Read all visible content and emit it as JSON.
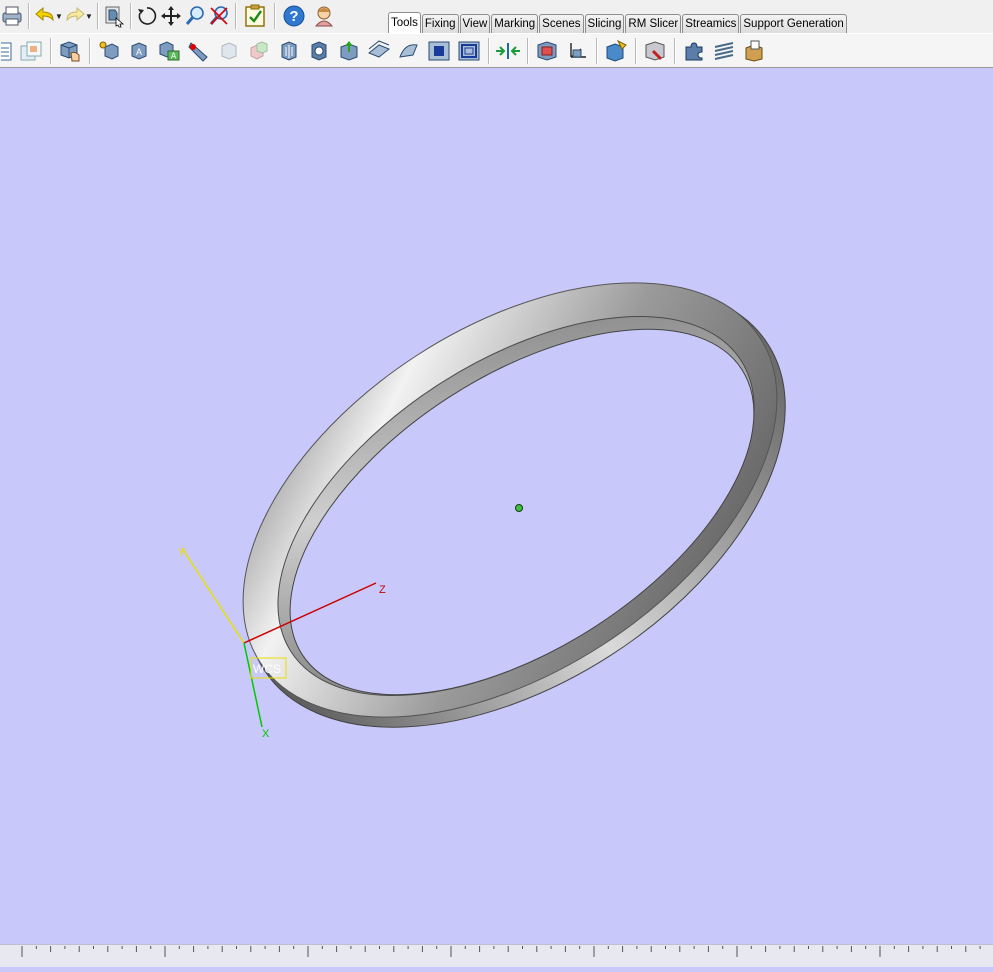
{
  "toolbar": {
    "top_icons": [
      "print-icon",
      "undo-icon",
      "redo-icon",
      "select-part-icon",
      "rotate-icon",
      "pan-icon",
      "zoom-icon",
      "zoom-fit-icon",
      "checklist-icon",
      "help-icon",
      "user-icon"
    ],
    "tool_icons": [
      "new-part-icon",
      "import-part-icon",
      "part-manager-icon",
      "part-tools-icon",
      "measure-icon",
      "label-icon",
      "cut-icon",
      "transparent-part-icon",
      "duplicate-part-icon",
      "shell-icon",
      "hollow-icon",
      "extrude-icon",
      "offset-surface-icon",
      "wrap-icon",
      "solid-view-icon",
      "wireframe-view-icon",
      "split-icon",
      "boolean-icon",
      "axis-transform-icon",
      "part-info-icon",
      "fix-wizard-icon",
      "puzzle-icon",
      "layers-icon",
      "box-icon"
    ]
  },
  "tabs": [
    {
      "label": "Tools",
      "active": true
    },
    {
      "label": "Fixing",
      "active": false
    },
    {
      "label": "View",
      "active": false
    },
    {
      "label": "Marking",
      "active": false
    },
    {
      "label": "Scenes",
      "active": false
    },
    {
      "label": "Slicing",
      "active": false
    },
    {
      "label": "RM Slicer",
      "active": false
    },
    {
      "label": "Streamics",
      "active": false
    },
    {
      "label": "Support Generation",
      "active": false
    }
  ],
  "viewport": {
    "background": "#c8c8fa",
    "wcs_label": "WCS",
    "axes": {
      "y_label": "Y",
      "z_label": "Z",
      "x_label": "X",
      "y_color": "#e8e000",
      "z_color": "#cc0000",
      "x_color": "#00c800"
    },
    "part": {
      "name": "ring",
      "color": "#8c8c8c",
      "center_marker_color": "#40c040"
    }
  }
}
